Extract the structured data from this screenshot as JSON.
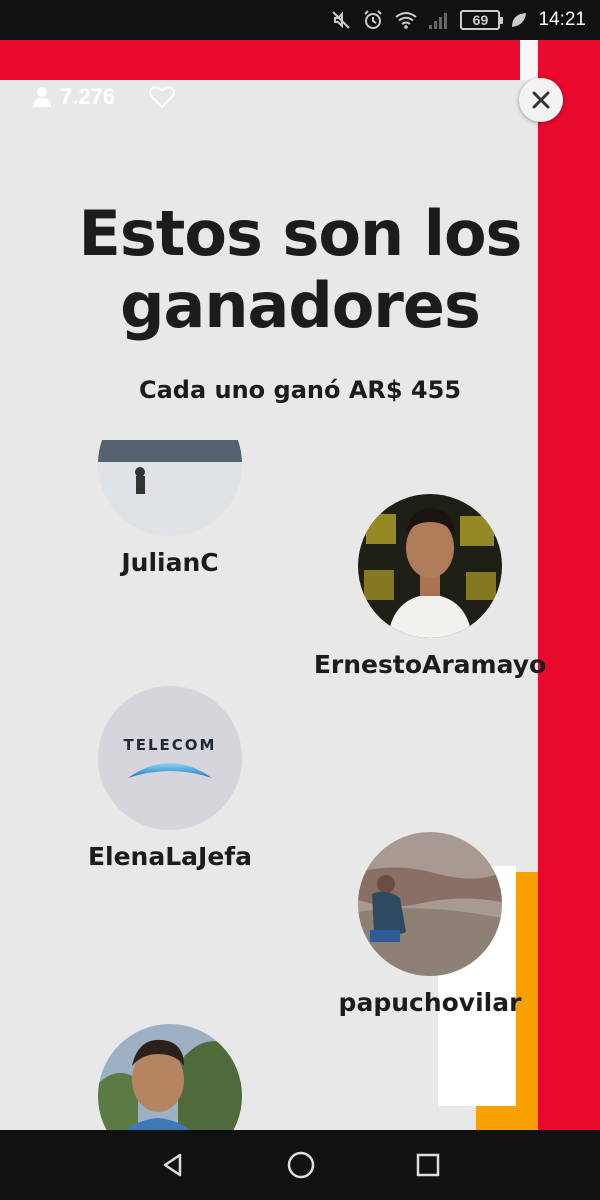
{
  "status_bar": {
    "battery": "69",
    "time": "14:21",
    "icons": [
      "mute-icon",
      "alarm-icon",
      "wifi-icon",
      "signal-icon",
      "battery-icon",
      "leaf-icon"
    ]
  },
  "header": {
    "viewers": "7.276"
  },
  "main": {
    "title": "Estos son los ganadores",
    "subtitle": "Cada uno ganó AR$ 455"
  },
  "winners": [
    {
      "name": "JulianC"
    },
    {
      "name": "ErnestoAramayo"
    },
    {
      "name": "ElenaLaJefa",
      "avatar_text": "TELECOM"
    },
    {
      "name": "papuchovilar"
    },
    {
      "name": ""
    }
  ],
  "colors": {
    "brand_red": "#e8092d",
    "accent_orange": "#f7a200",
    "background": "#e8e8e8"
  },
  "nav": [
    "back-icon",
    "home-icon",
    "recents-icon"
  ]
}
